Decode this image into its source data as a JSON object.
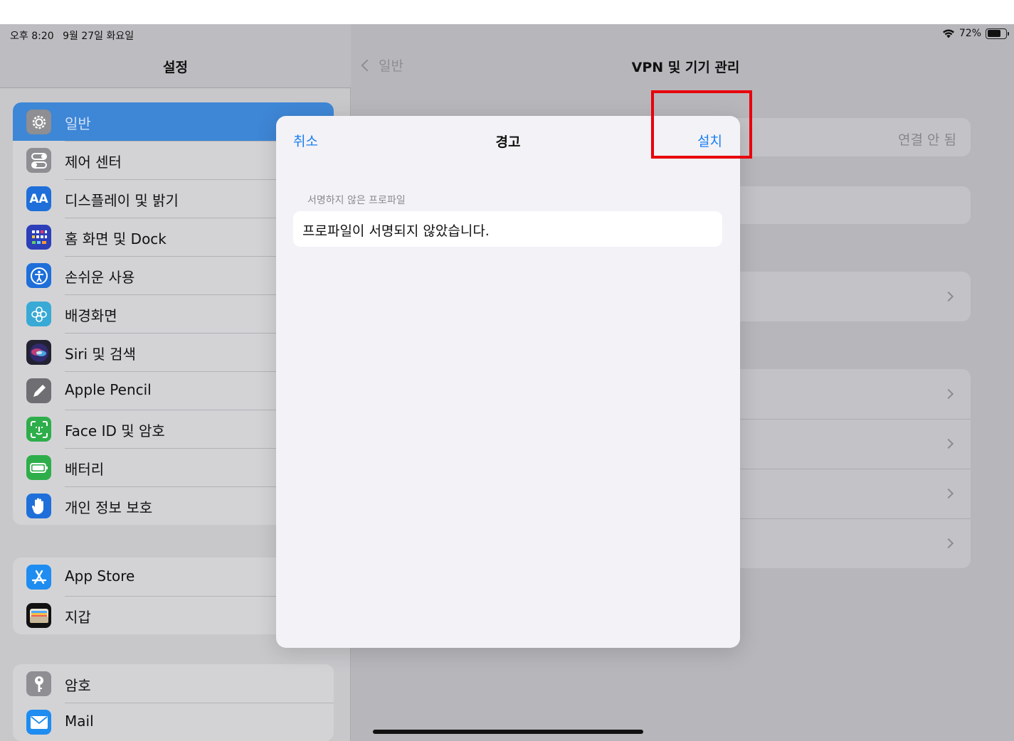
{
  "status_bar": {
    "time": "오후 8:20",
    "date": "9월 27일 화요일",
    "battery": "72%",
    "battery_level": 0.72
  },
  "sidebar": {
    "title": "설정",
    "groups": [
      [
        {
          "label": "일반",
          "icon": "gear-icon",
          "color": "#8e8e93",
          "selected": true
        },
        {
          "label": "제어 센터",
          "icon": "toggles-icon",
          "color": "#8e8e93"
        },
        {
          "label": "디스플레이 및 밝기",
          "icon": "text-size-icon",
          "color": "#1e6fd9"
        },
        {
          "label": "홈 화면 및 Dock",
          "icon": "grid-icon",
          "color": "#2c3fb8"
        },
        {
          "label": "손쉬운 사용",
          "icon": "accessibility-icon",
          "color": "#1e6fd9"
        },
        {
          "label": "배경화면",
          "icon": "flower-icon",
          "color": "#39a9d6"
        },
        {
          "label": "Siri 및 검색",
          "icon": "siri-icon",
          "color": "#222233"
        },
        {
          "label": "Apple Pencil",
          "icon": "pencil-icon",
          "color": "#6e6e73"
        },
        {
          "label": "Face ID 및 암호",
          "icon": "face-id-icon",
          "color": "#2eae4a"
        },
        {
          "label": "배터리",
          "icon": "battery-icon",
          "color": "#2eae4a"
        },
        {
          "label": "개인 정보 보호",
          "icon": "hand-icon",
          "color": "#1e6fd9"
        }
      ],
      [
        {
          "label": "App Store",
          "icon": "app-store-icon",
          "color": "#1e8cf0"
        },
        {
          "label": "지갑",
          "icon": "wallet-icon",
          "color": "#111111"
        }
      ],
      [
        {
          "label": "암호",
          "icon": "key-icon",
          "color": "#8e8e93"
        },
        {
          "label": "Mail",
          "icon": "mail-icon",
          "color": "#1e8cf0"
        }
      ]
    ]
  },
  "detail": {
    "back_label": "일반",
    "title": "VPN 및 기기 관리",
    "vpn_status": "연결 안 됨"
  },
  "modal": {
    "cancel_label": "취소",
    "title": "경고",
    "install_label": "설치",
    "section_label": "서명하지 않은 프로파일",
    "message": "프로파일이 서명되지 않았습니다."
  },
  "colors": {
    "accent": "#1a7ef0",
    "highlight": "#e8000b",
    "selected_row": "#3e86d6"
  }
}
